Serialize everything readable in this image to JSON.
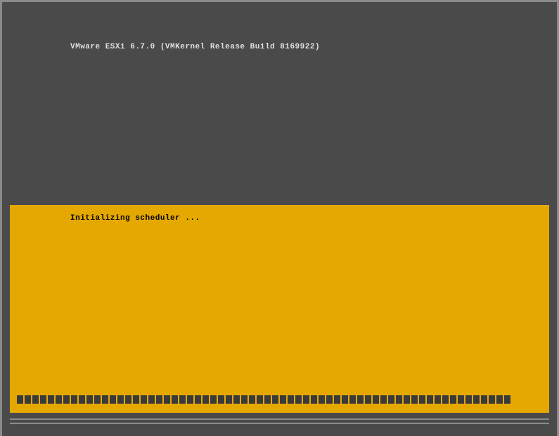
{
  "boot_screen": {
    "product_line": "VMware ESXi 6.7.0 (VMKernel Release Build 8169922)",
    "status_line": "Initializing scheduler ...",
    "progress_ticks": 64
  }
}
